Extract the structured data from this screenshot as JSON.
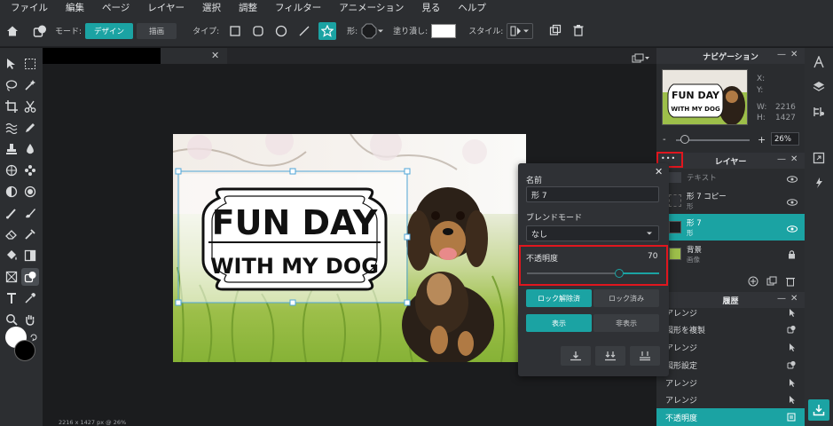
{
  "menu": [
    "ファイル",
    "編集",
    "ページ",
    "レイヤー",
    "選択",
    "調整",
    "フィルター",
    "アニメーション",
    "見る",
    "ヘルプ"
  ],
  "toolbar": {
    "mode_label": "モード:",
    "mode_design": "デザイン",
    "mode_draw": "描画",
    "type_label": "タイプ:",
    "shape_label": "形:",
    "fill_label": "塗り潰し:",
    "style_label": "スタイル:",
    "fill_color": "#ffffff"
  },
  "canvas": {
    "banner_line1": "FUN DAY",
    "banner_line2": "WITH MY DOG",
    "status": "2216 x 1427 px @ 26%"
  },
  "navigation": {
    "title": "ナビゲーション",
    "x_label": "X:",
    "y_label": "Y:",
    "w_label": "W:",
    "w_value": "2216",
    "h_label": "H:",
    "h_value": "1427",
    "zoom_value": "26%",
    "thumb_line1": "FUN DAY",
    "thumb_line2": "WITH MY DOG"
  },
  "layers": {
    "title": "レイヤー",
    "more": "•••",
    "items": [
      {
        "name": "テキスト",
        "sub": ""
      },
      {
        "name": "形 7 コピー",
        "sub": "形"
      },
      {
        "name": "形 7",
        "sub": "形"
      },
      {
        "name": "背景",
        "sub": "画像"
      }
    ]
  },
  "history": {
    "title": "履歴",
    "items": [
      "アレンジ",
      "図形を複製",
      "アレンジ",
      "図形設定",
      "アレンジ",
      "アレンジ",
      "不透明度"
    ]
  },
  "properties": {
    "name_label": "名前",
    "name_value": "形 7",
    "blend_label": "ブレンドモード",
    "blend_value": "なし",
    "opacity_label": "不透明度",
    "opacity_value": "70",
    "opacity_fraction": 0.7,
    "unlock_label": "ロック解除済",
    "lock_label": "ロック済み",
    "show_label": "表示",
    "hide_label": "非表示"
  },
  "colors": {
    "accent": "#1ba3a3",
    "highlight": "#e0161e"
  }
}
